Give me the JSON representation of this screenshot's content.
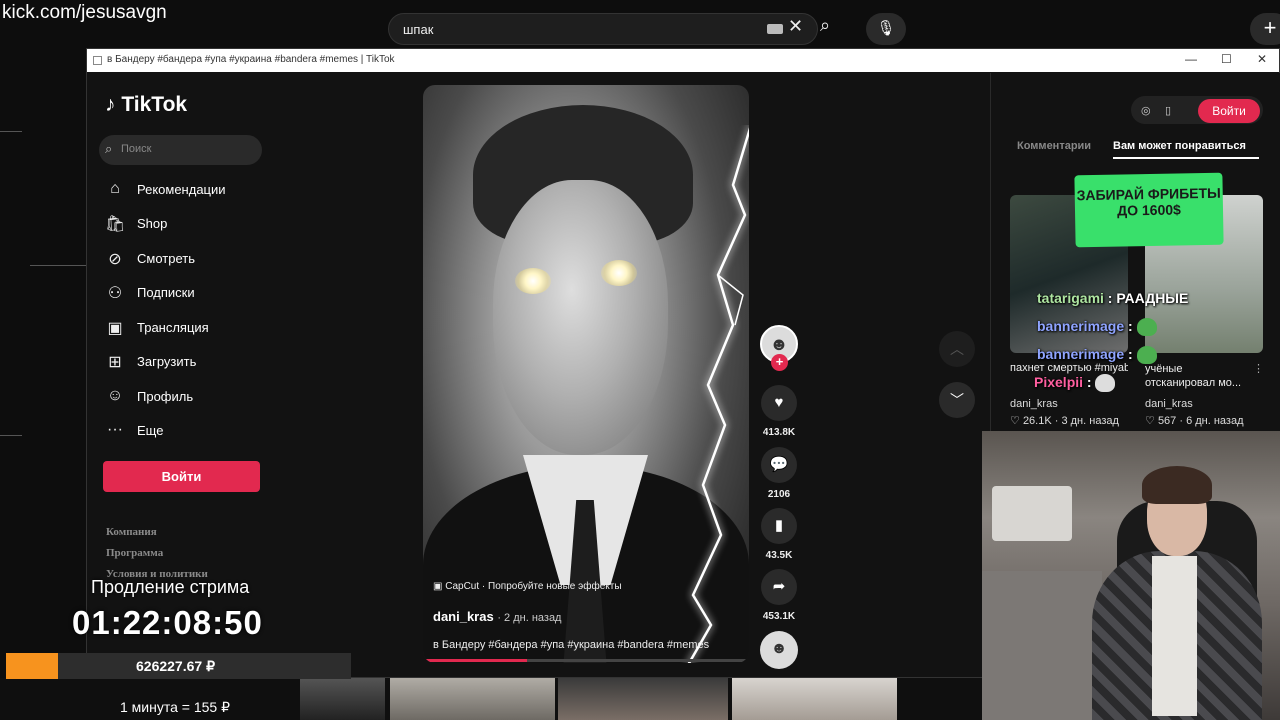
{
  "browser": {
    "url": "kick.com/jesusavgn",
    "search_value": "шпак"
  },
  "window": {
    "title": "в Бандеру #бандера #упа #украина #bandera #memes | TikTok"
  },
  "sidebar": {
    "logo": "TikTok",
    "search_placeholder": "Поиск",
    "items": [
      {
        "label": "Рекомендации",
        "icon": "home-icon"
      },
      {
        "label": "Shop",
        "icon": "shop-icon"
      },
      {
        "label": "Смотреть",
        "icon": "compass-icon"
      },
      {
        "label": "Подписки",
        "icon": "following-icon"
      },
      {
        "label": "Трансляция",
        "icon": "live-icon"
      },
      {
        "label": "Загрузить",
        "icon": "upload-icon"
      },
      {
        "label": "Профиль",
        "icon": "profile-icon"
      },
      {
        "label": "Еще",
        "icon": "more-icon"
      }
    ],
    "login": "Войти",
    "footer": [
      "Компания",
      "Программа",
      "Условия и политики"
    ]
  },
  "video": {
    "capcut": "CapCut · Попробуйте новые эффекты",
    "author": "dani_kras",
    "ago": "· 2 дн. назад",
    "caption": "в Бандеру #бандера #упа #украина #bandera #memes",
    "progress": 0.32,
    "likes": "413.8K",
    "comments": "2106",
    "saves": "43.5K",
    "shares": "453.1K"
  },
  "right_panel": {
    "login": "Войти",
    "tabs": [
      "Комментарии",
      "Вам может понравиться"
    ],
    "recs": [
      {
        "title": "пахнет смертью #miyabi #zzz...",
        "author": "dani_kras",
        "likes": "26.1K",
        "ago": "3 дн. назад"
      },
      {
        "title": "учёные отсканировал мо...",
        "author": "dani_kras",
        "likes": "567",
        "ago": "6 дн. назад"
      }
    ]
  },
  "ad": {
    "text": "ЗАБИРАЙ ФРИБЕТЫ ДО 1600$"
  },
  "chat": [
    {
      "user": "tatarigami",
      "msg": "РААДНЫЕ"
    },
    {
      "user": "bannerimage",
      "msg": ""
    },
    {
      "user": "bannerimage",
      "msg": ""
    },
    {
      "user": "Pixelpii",
      "msg": ""
    }
  ],
  "stream": {
    "prolong_label": "Продление стрима",
    "timer": "01:22:08:50",
    "money": "626227.67 ₽",
    "money_progress": 0.15,
    "rate": "1 минута = 155 ₽"
  },
  "colors": {
    "accent": "#e2294f",
    "ad_green": "#39e06b",
    "money_orange": "#f7931e"
  }
}
